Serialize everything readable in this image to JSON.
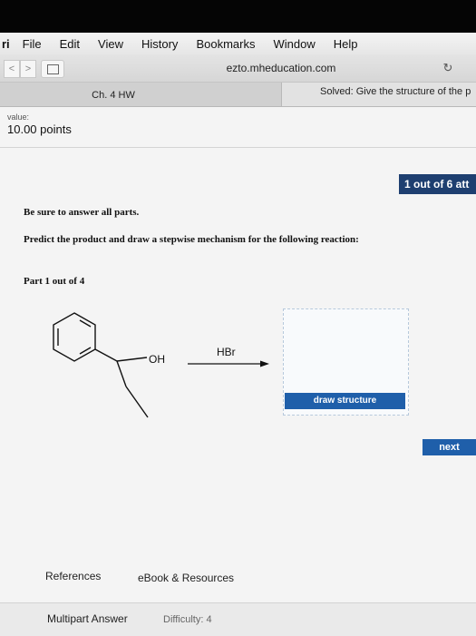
{
  "menu": {
    "app": "ri",
    "items": [
      "File",
      "Edit",
      "View",
      "History",
      "Bookmarks",
      "Window",
      "Help"
    ]
  },
  "toolbar": {
    "back_glyph": "<",
    "forward_glyph": ">",
    "address": "ezto.mheducation.com",
    "reload_glyph": "↻"
  },
  "tabs": {
    "active": "Ch. 4 HW",
    "second": "Solved: Give the structure of the p"
  },
  "assignment": {
    "value_label": "value:",
    "points": "10.00 points",
    "attempts": "1 out of 6 att"
  },
  "question": {
    "instruction": "Be sure to answer all parts.",
    "prompt": "Predict the product and draw a stepwise mechanism for the following reaction:",
    "part": "Part 1 out of 4",
    "hydroxyl_label": "OH",
    "reagent": "HBr"
  },
  "buttons": {
    "draw_structure": "draw structure",
    "next": "next"
  },
  "footer": {
    "references": "References",
    "ebook": "eBook & Resources",
    "multipart": "Multipart Answer",
    "difficulty": "Difficulty: 4"
  },
  "colors": {
    "accent_blue": "#1f5faa",
    "attempts_navy": "#1e3f70"
  }
}
